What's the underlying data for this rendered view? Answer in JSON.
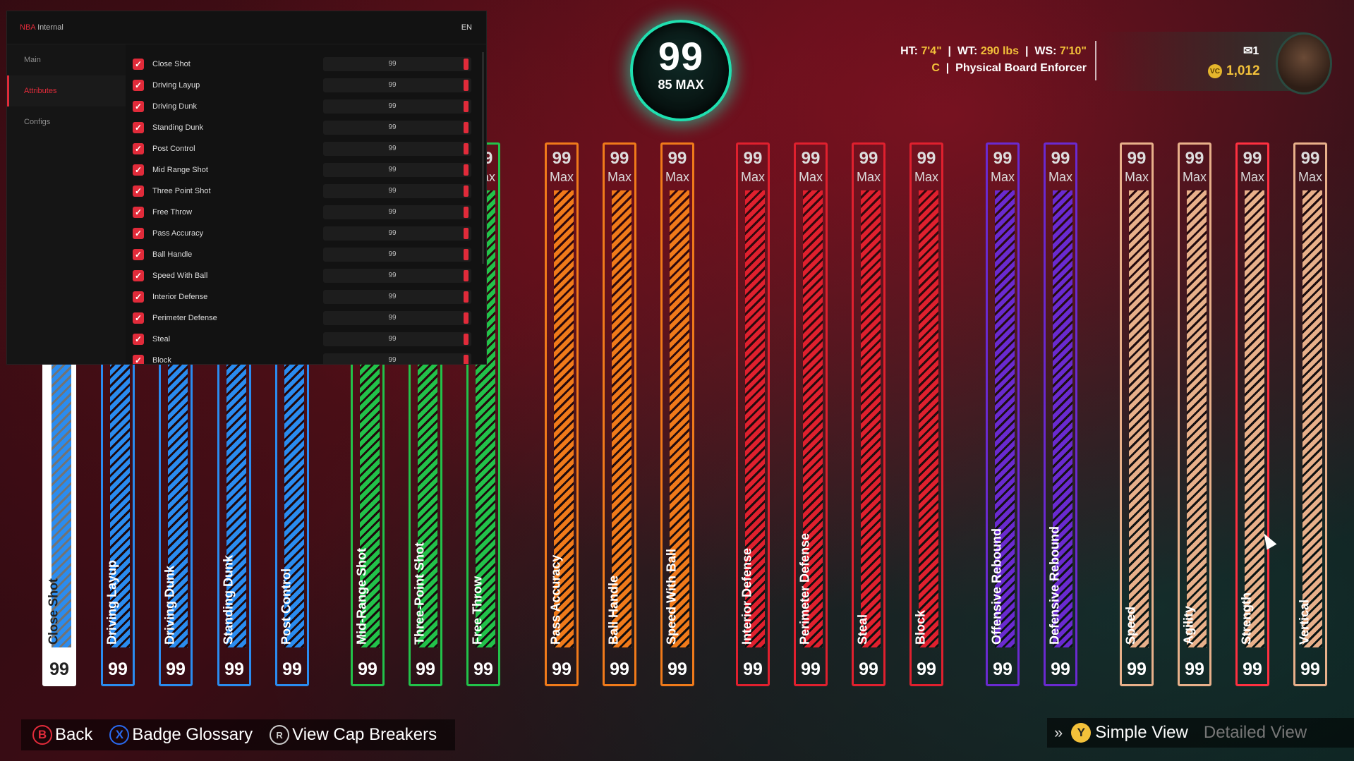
{
  "overall": {
    "rating": "99",
    "max_label": "85 MAX",
    "ring_color": "#1fe0b0"
  },
  "player": {
    "ht_label": "HT:",
    "ht": "7'4\"",
    "wt_label": "WT:",
    "wt": "290 lbs",
    "ws_label": "WS:",
    "ws": "7'10\"",
    "position": "C",
    "archetype": "Physical Board Enforcer",
    "count": "1",
    "vc": "1,012"
  },
  "bars": [
    {
      "name": "Close Shot",
      "value": "99",
      "color": "#2a8cf0",
      "active": true
    },
    {
      "name": "Driving Layup",
      "value": "99",
      "color": "#2a8cf0"
    },
    {
      "name": "Driving Dunk",
      "value": "99",
      "color": "#2a8cf0"
    },
    {
      "name": "Standing Dunk",
      "value": "99",
      "color": "#2a8cf0"
    },
    {
      "name": "Post Control",
      "value": "99",
      "color": "#2a8cf0"
    },
    {
      "name": "Mid-Range Shot",
      "value": "99",
      "color": "#22c24a"
    },
    {
      "name": "Three-Point Shot",
      "value": "99",
      "color": "#22c24a"
    },
    {
      "name": "Free Throw",
      "value": "99",
      "color": "#22c24a",
      "max": "Max"
    },
    {
      "name": "Pass Accuracy",
      "value": "99",
      "color": "#f07a1a",
      "max": "Max"
    },
    {
      "name": "Ball Handle",
      "value": "99",
      "color": "#f07a1a",
      "max": "Max"
    },
    {
      "name": "Speed With Ball",
      "value": "99",
      "color": "#f07a1a",
      "max": "Max"
    },
    {
      "name": "Interior Defense",
      "value": "99",
      "color": "#e0202e",
      "max": "Max"
    },
    {
      "name": "Perimeter Defense",
      "value": "99",
      "color": "#e0202e",
      "max": "Max"
    },
    {
      "name": "Steal",
      "value": "99",
      "color": "#e0202e",
      "max": "Max"
    },
    {
      "name": "Block",
      "value": "99",
      "color": "#e0202e",
      "max": "Max"
    },
    {
      "name": "Offensive Rebound",
      "value": "99",
      "color": "#6a2ad0",
      "max": "Max"
    },
    {
      "name": "Defensive Rebound",
      "value": "99",
      "color": "#6a2ad0",
      "max": "Max"
    },
    {
      "name": "Speed",
      "value": "99",
      "color": "#e8b08a",
      "max": "Max"
    },
    {
      "name": "Agility",
      "value": "99",
      "color": "#e8b08a",
      "max": "Max"
    },
    {
      "name": "Strength",
      "value": "99",
      "color": "#e8b08a",
      "max": "Max",
      "highlight": true
    },
    {
      "name": "Vertical",
      "value": "99",
      "color": "#e8b08a",
      "max": "Max"
    }
  ],
  "panel": {
    "brand": "NBA",
    "title": "Internal",
    "lang": "EN",
    "nav": [
      {
        "label": "Main"
      },
      {
        "label": "Attributes",
        "active": true
      },
      {
        "label": "Configs"
      }
    ],
    "attributes": [
      {
        "label": "Close Shot",
        "value": "99"
      },
      {
        "label": "Driving Layup",
        "value": "99"
      },
      {
        "label": "Driving Dunk",
        "value": "99"
      },
      {
        "label": "Standing Dunk",
        "value": "99"
      },
      {
        "label": "Post Control",
        "value": "99"
      },
      {
        "label": "Mid Range Shot",
        "value": "99"
      },
      {
        "label": "Three Point Shot",
        "value": "99"
      },
      {
        "label": "Free Throw",
        "value": "99"
      },
      {
        "label": "Pass Accuracy",
        "value": "99"
      },
      {
        "label": "Ball Handle",
        "value": "99"
      },
      {
        "label": "Speed With Ball",
        "value": "99"
      },
      {
        "label": "Interior Defense",
        "value": "99"
      },
      {
        "label": "Perimeter Defense",
        "value": "99"
      },
      {
        "label": "Steal",
        "value": "99"
      },
      {
        "label": "Block",
        "value": "99"
      }
    ]
  },
  "footer": {
    "back": {
      "key": "B",
      "label": "Back",
      "color": "#e12b3a"
    },
    "glossary": {
      "key": "X",
      "label": "Badge Glossary",
      "color": "#2a6af0"
    },
    "cap": {
      "key": "R",
      "label": "View Cap Breakers",
      "color": "#cccccc"
    },
    "simple_key": "Y",
    "simple": "Simple View",
    "detailed": "Detailed View"
  }
}
